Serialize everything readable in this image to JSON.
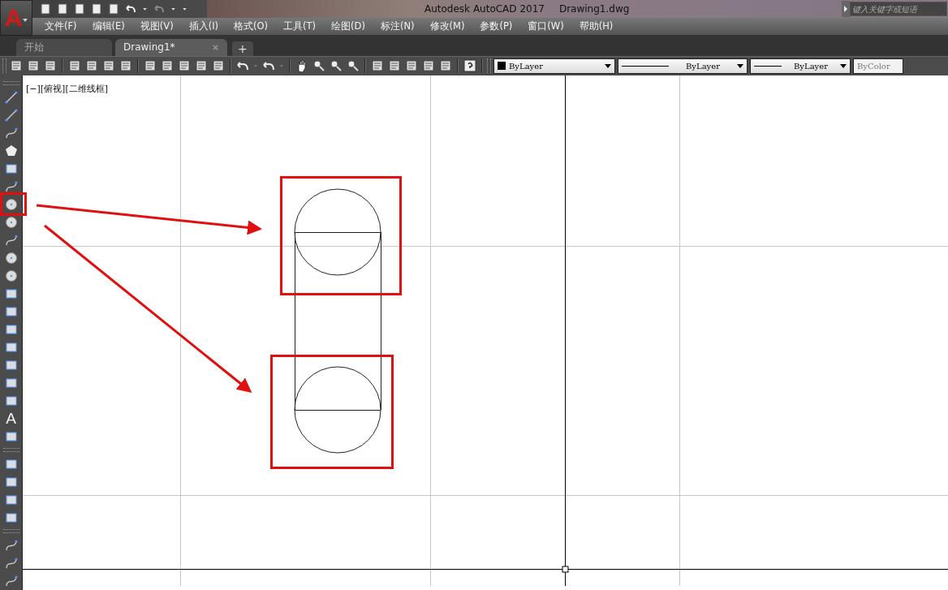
{
  "app_button": {
    "label": "A"
  },
  "title_bar": {
    "app_name": "Autodesk AutoCAD 2017",
    "file_name": "Drawing1.dwg",
    "search": {
      "placeholder": "键入关键字或短语"
    }
  },
  "menu": [
    "文件(F)",
    "编辑(E)",
    "视图(V)",
    "插入(I)",
    "格式(O)",
    "工具(T)",
    "绘图(D)",
    "标注(N)",
    "修改(M)",
    "参数(P)",
    "窗口(W)",
    "帮助(H)"
  ],
  "tabs": [
    {
      "label": "开始",
      "selected": false
    },
    {
      "label": "Drawing1*",
      "selected": true
    }
  ],
  "new_tab": {
    "label": "+"
  },
  "properties": {
    "color_setting": "ByLayer",
    "linetype": "ByLayer",
    "lineweight": "ByLayer",
    "plot_style": "ByColor"
  },
  "viewport": {
    "label": "[−][俯视][二维线框]"
  },
  "draw_toolbar": {
    "text_tool": "A"
  }
}
